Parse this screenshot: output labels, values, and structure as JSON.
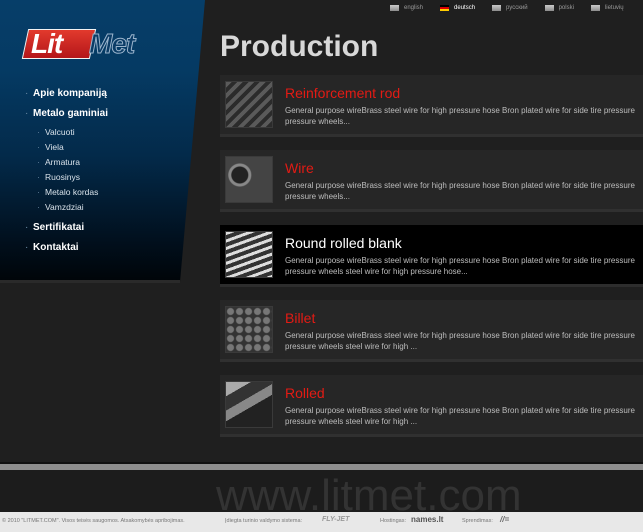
{
  "logo": {
    "part1": "Lit",
    "part2": "Met"
  },
  "languages": [
    {
      "label": "english",
      "active": false
    },
    {
      "label": "deutsch",
      "active": true
    },
    {
      "label": "русский",
      "active": false
    },
    {
      "label": "polski",
      "active": false
    },
    {
      "label": "lietuvių",
      "active": false
    }
  ],
  "nav": {
    "items": [
      {
        "label": "Apie kompaniją"
      },
      {
        "label": "Metalo gaminiai"
      },
      {
        "label": "Sertifikatai"
      },
      {
        "label": "Kontaktai"
      }
    ],
    "subitems": [
      {
        "label": "Valcuoti"
      },
      {
        "label": "Viela"
      },
      {
        "label": "Armatura"
      },
      {
        "label": "Ruosinys"
      },
      {
        "label": "Metalo kordas"
      },
      {
        "label": "Vamzdziai"
      }
    ]
  },
  "page_title": "Production",
  "products": [
    {
      "title": "Reinforcement rod",
      "desc": "General purpose wireBrass steel wire for high pressure hose Bron plated wire for side tire pressure pressure wheels..."
    },
    {
      "title": "Wire",
      "desc": "General purpose wireBrass steel wire for high pressure hose Bron plated wire for side tire pressure pressure wheels..."
    },
    {
      "title": "Round rolled blank",
      "desc": "General purpose wireBrass steel wire for high pressure hose Bron plated wire for side tire pressure pressure wheels steel wire for high pressure hose..."
    },
    {
      "title": "Billet",
      "desc": "General purpose wireBrass steel wire for high pressure hose Bron plated wire for side tire pressure pressure wheels steel wire for high ..."
    },
    {
      "title": "Rolled",
      "desc": "General purpose wireBrass steel wire for high pressure hose Bron plated wire for side tire pressure pressure wheels steel wire for high ..."
    }
  ],
  "footer": {
    "watermark": "www.litmet.com",
    "copyright": "© 2010 \"LITMET.COM\". Visos teisės saugomos. Atsakomybės apribojimas.",
    "cms_label": "Įdiegta turinio valdymo sistema:",
    "cms_brand": "FLY-JET",
    "hosting_label": "Hostingas:",
    "hosting_brand": "names.lt",
    "solution_label": "Sprendimas:",
    "solution_brand": "//="
  },
  "colors": {
    "accent_red": "#e31b14",
    "sidebar_blue": "#063e69"
  }
}
